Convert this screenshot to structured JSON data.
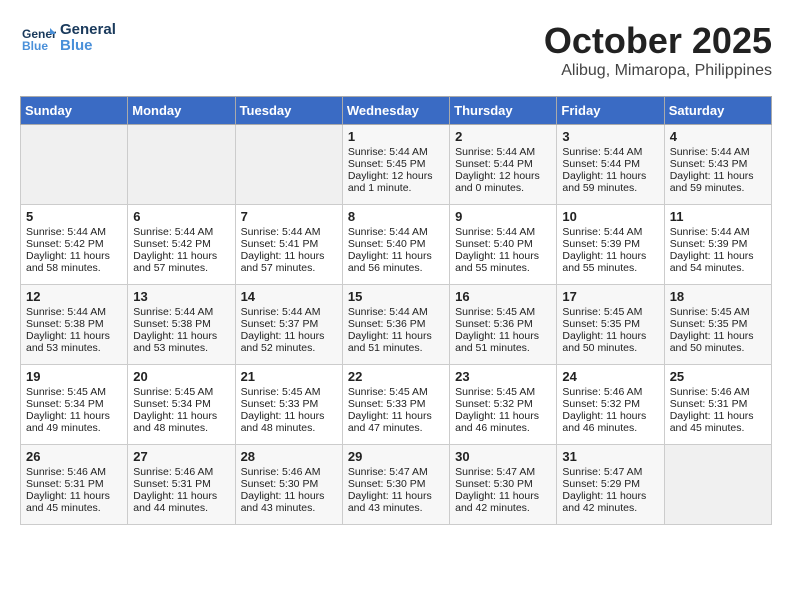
{
  "header": {
    "logo_line1": "General",
    "logo_line2": "Blue",
    "month": "October 2025",
    "location": "Alibug, Mimaropa, Philippines"
  },
  "weekdays": [
    "Sunday",
    "Monday",
    "Tuesday",
    "Wednesday",
    "Thursday",
    "Friday",
    "Saturday"
  ],
  "weeks": [
    [
      {
        "day": "",
        "empty": true
      },
      {
        "day": "",
        "empty": true
      },
      {
        "day": "",
        "empty": true
      },
      {
        "day": "1",
        "sunrise": "5:44 AM",
        "sunset": "5:45 PM",
        "daylight": "12 hours and 1 minute."
      },
      {
        "day": "2",
        "sunrise": "5:44 AM",
        "sunset": "5:44 PM",
        "daylight": "12 hours and 0 minutes."
      },
      {
        "day": "3",
        "sunrise": "5:44 AM",
        "sunset": "5:44 PM",
        "daylight": "11 hours and 59 minutes."
      },
      {
        "day": "4",
        "sunrise": "5:44 AM",
        "sunset": "5:43 PM",
        "daylight": "11 hours and 59 minutes."
      }
    ],
    [
      {
        "day": "5",
        "sunrise": "5:44 AM",
        "sunset": "5:42 PM",
        "daylight": "11 hours and 58 minutes."
      },
      {
        "day": "6",
        "sunrise": "5:44 AM",
        "sunset": "5:42 PM",
        "daylight": "11 hours and 57 minutes."
      },
      {
        "day": "7",
        "sunrise": "5:44 AM",
        "sunset": "5:41 PM",
        "daylight": "11 hours and 57 minutes."
      },
      {
        "day": "8",
        "sunrise": "5:44 AM",
        "sunset": "5:40 PM",
        "daylight": "11 hours and 56 minutes."
      },
      {
        "day": "9",
        "sunrise": "5:44 AM",
        "sunset": "5:40 PM",
        "daylight": "11 hours and 55 minutes."
      },
      {
        "day": "10",
        "sunrise": "5:44 AM",
        "sunset": "5:39 PM",
        "daylight": "11 hours and 55 minutes."
      },
      {
        "day": "11",
        "sunrise": "5:44 AM",
        "sunset": "5:39 PM",
        "daylight": "11 hours and 54 minutes."
      }
    ],
    [
      {
        "day": "12",
        "sunrise": "5:44 AM",
        "sunset": "5:38 PM",
        "daylight": "11 hours and 53 minutes."
      },
      {
        "day": "13",
        "sunrise": "5:44 AM",
        "sunset": "5:38 PM",
        "daylight": "11 hours and 53 minutes."
      },
      {
        "day": "14",
        "sunrise": "5:44 AM",
        "sunset": "5:37 PM",
        "daylight": "11 hours and 52 minutes."
      },
      {
        "day": "15",
        "sunrise": "5:44 AM",
        "sunset": "5:36 PM",
        "daylight": "11 hours and 51 minutes."
      },
      {
        "day": "16",
        "sunrise": "5:45 AM",
        "sunset": "5:36 PM",
        "daylight": "11 hours and 51 minutes."
      },
      {
        "day": "17",
        "sunrise": "5:45 AM",
        "sunset": "5:35 PM",
        "daylight": "11 hours and 50 minutes."
      },
      {
        "day": "18",
        "sunrise": "5:45 AM",
        "sunset": "5:35 PM",
        "daylight": "11 hours and 50 minutes."
      }
    ],
    [
      {
        "day": "19",
        "sunrise": "5:45 AM",
        "sunset": "5:34 PM",
        "daylight": "11 hours and 49 minutes."
      },
      {
        "day": "20",
        "sunrise": "5:45 AM",
        "sunset": "5:34 PM",
        "daylight": "11 hours and 48 minutes."
      },
      {
        "day": "21",
        "sunrise": "5:45 AM",
        "sunset": "5:33 PM",
        "daylight": "11 hours and 48 minutes."
      },
      {
        "day": "22",
        "sunrise": "5:45 AM",
        "sunset": "5:33 PM",
        "daylight": "11 hours and 47 minutes."
      },
      {
        "day": "23",
        "sunrise": "5:45 AM",
        "sunset": "5:32 PM",
        "daylight": "11 hours and 46 minutes."
      },
      {
        "day": "24",
        "sunrise": "5:46 AM",
        "sunset": "5:32 PM",
        "daylight": "11 hours and 46 minutes."
      },
      {
        "day": "25",
        "sunrise": "5:46 AM",
        "sunset": "5:31 PM",
        "daylight": "11 hours and 45 minutes."
      }
    ],
    [
      {
        "day": "26",
        "sunrise": "5:46 AM",
        "sunset": "5:31 PM",
        "daylight": "11 hours and 45 minutes."
      },
      {
        "day": "27",
        "sunrise": "5:46 AM",
        "sunset": "5:31 PM",
        "daylight": "11 hours and 44 minutes."
      },
      {
        "day": "28",
        "sunrise": "5:46 AM",
        "sunset": "5:30 PM",
        "daylight": "11 hours and 43 minutes."
      },
      {
        "day": "29",
        "sunrise": "5:47 AM",
        "sunset": "5:30 PM",
        "daylight": "11 hours and 43 minutes."
      },
      {
        "day": "30",
        "sunrise": "5:47 AM",
        "sunset": "5:30 PM",
        "daylight": "11 hours and 42 minutes."
      },
      {
        "day": "31",
        "sunrise": "5:47 AM",
        "sunset": "5:29 PM",
        "daylight": "11 hours and 42 minutes."
      },
      {
        "day": "",
        "empty": true
      }
    ]
  ]
}
